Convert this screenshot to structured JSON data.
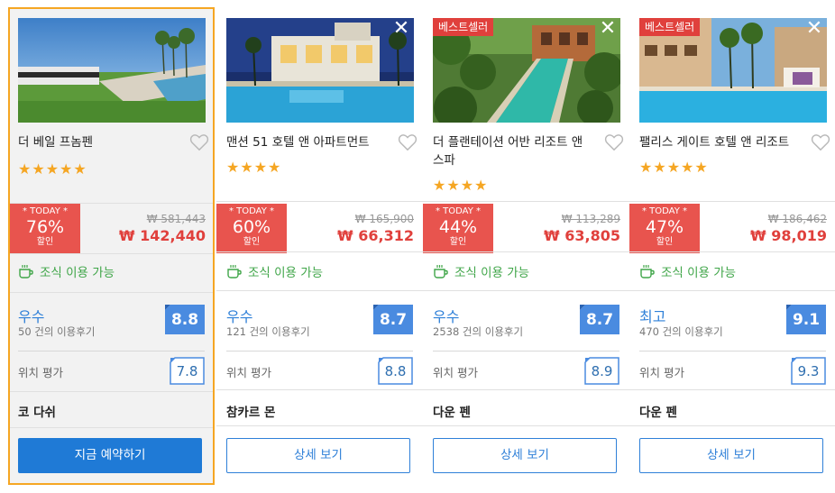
{
  "colors": {
    "accent": "#2f80d8",
    "deal_red": "#e8544e",
    "price_red": "#e0403c",
    "breakfast_green": "#3fa548",
    "selected_border": "#f5a623",
    "star": "#f5a623"
  },
  "hotels": [
    {
      "name": "더 베일 프놈펜",
      "bestseller": "",
      "stars": "★★★★★",
      "today_label": "* TODAY *",
      "discount": "76%",
      "discount_label": "할인",
      "old_price": "₩ 581,443",
      "new_price": "₩ 142,440",
      "breakfast": "조식 이용 가능",
      "rating_word": "우수",
      "review_count": "50 건의 이용후기",
      "score": "8.8",
      "location_label": "위치 평가",
      "location_score": "7.8",
      "area": "코 다쉬",
      "button": "지금 예약하기"
    },
    {
      "name": "맨션 51 호텔 앤 아파트먼트",
      "bestseller": "",
      "stars": "★★★★",
      "today_label": "* TODAY *",
      "discount": "60%",
      "discount_label": "할인",
      "old_price": "₩ 165,900",
      "new_price": "₩ 66,312",
      "breakfast": "조식 이용 가능",
      "rating_word": "우수",
      "review_count": "121 건의 이용후기",
      "score": "8.7",
      "location_label": "위치 평가",
      "location_score": "8.8",
      "area": "참카르 몬",
      "button": "상세 보기"
    },
    {
      "name": "더 플랜테이션 어반 리조트 앤 스파",
      "bestseller": "베스트셀러",
      "stars": "★★★★",
      "today_label": "* TODAY *",
      "discount": "44%",
      "discount_label": "할인",
      "old_price": "₩ 113,289",
      "new_price": "₩ 63,805",
      "breakfast": "조식 이용 가능",
      "rating_word": "우수",
      "review_count": "2538 건의 이용후기",
      "score": "8.7",
      "location_label": "위치 평가",
      "location_score": "8.9",
      "area": "다운 펜",
      "button": "상세 보기"
    },
    {
      "name": "팰리스 게이트 호텔 앤 리조트",
      "bestseller": "베스트셀러",
      "stars": "★★★★★",
      "today_label": "* TODAY *",
      "discount": "47%",
      "discount_label": "할인",
      "old_price": "₩ 186,462",
      "new_price": "₩ 98,019",
      "breakfast": "조식 이용 가능",
      "rating_word": "최고",
      "review_count": "470 건의 이용후기",
      "score": "9.1",
      "location_label": "위치 평가",
      "location_score": "9.3",
      "area": "다운 펜",
      "button": "상세 보기"
    }
  ]
}
